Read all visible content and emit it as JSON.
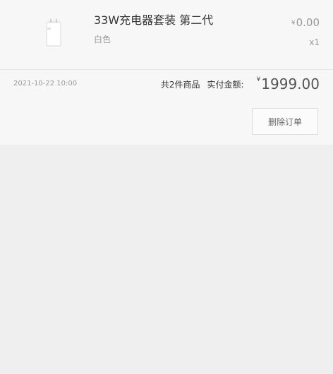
{
  "order": {
    "product": {
      "name": "33W充电器套装 第二代",
      "variant": "白色",
      "price_symbol": "¥",
      "price": "0.00",
      "quantity": "x1",
      "thumbnail_icon": "charger-icon"
    },
    "date": "2021-10-22 10:00",
    "item_count": "共2件商品",
    "paid_label": "实付金额:",
    "total_symbol": "¥",
    "total": "1999.00",
    "delete_label": "删除订单"
  }
}
